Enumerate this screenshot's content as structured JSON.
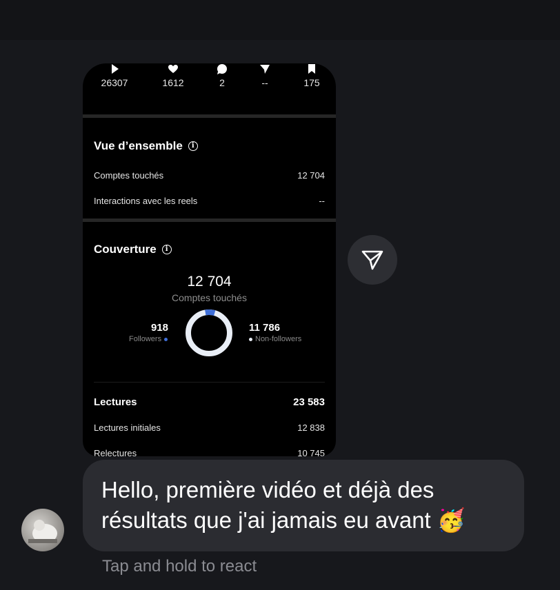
{
  "stats": [
    {
      "icon": "play-icon",
      "value": "26307"
    },
    {
      "icon": "heart-icon",
      "value": "1612"
    },
    {
      "icon": "comment-icon",
      "value": "2"
    },
    {
      "icon": "share-icon",
      "value": "--"
    },
    {
      "icon": "bookmark-icon",
      "value": "175"
    }
  ],
  "overview": {
    "title": "Vue d’ensemble",
    "rows": [
      {
        "label": "Comptes touchés",
        "value": "12 704"
      },
      {
        "label": "Interactions avec les reels",
        "value": "--"
      }
    ]
  },
  "coverage": {
    "title": "Couverture",
    "total": "12 704",
    "total_label": "Comptes touchés",
    "followers_value": "918",
    "followers_label": "Followers",
    "nonfollowers_value": "11 786",
    "nonfollowers_label": "Non-followers",
    "followers_fraction": 0.072,
    "followers_color": "#3f6fd8",
    "nonfollowers_color": "#e9eef6"
  },
  "plays": {
    "title": "Lectures",
    "total": "23 583",
    "rows": [
      {
        "label": "Lectures initiales",
        "value": "12 838"
      },
      {
        "label": "Relectures",
        "value": "10 745"
      }
    ]
  },
  "message": {
    "text": "Hello, première vidéo et déjà des résultats que j'ai jamais eu avant 🥳",
    "hint": "Tap and hold to react"
  }
}
